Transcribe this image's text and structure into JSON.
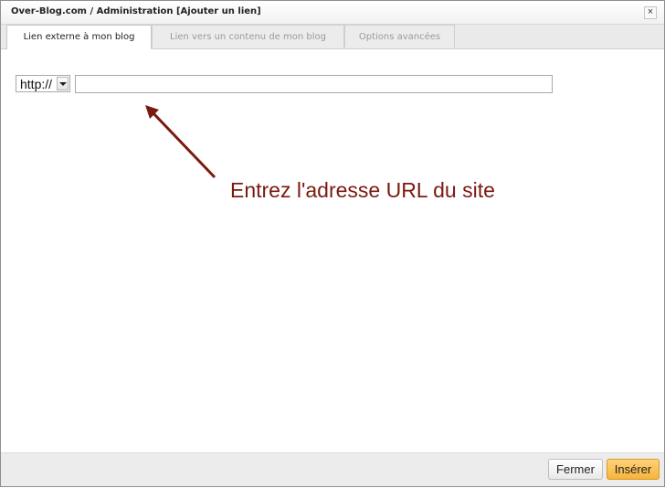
{
  "dialog": {
    "title": "Over-Blog.com / Administration [Ajouter un lien]",
    "close_glyph": "×",
    "close_icon": "close-icon"
  },
  "tabs": [
    {
      "label": "Lien externe à mon blog",
      "active": true
    },
    {
      "label": "Lien vers un contenu de mon blog",
      "active": false
    },
    {
      "label": "Options avancées",
      "active": false
    }
  ],
  "form": {
    "protocol_selected": "http://",
    "url_value": ""
  },
  "annotation": {
    "text": "Entrez l'adresse URL du site",
    "color": "#7a1a10"
  },
  "footer": {
    "close_label": "Fermer",
    "insert_label": "Insérer",
    "insert_color": "#f7b43a"
  }
}
